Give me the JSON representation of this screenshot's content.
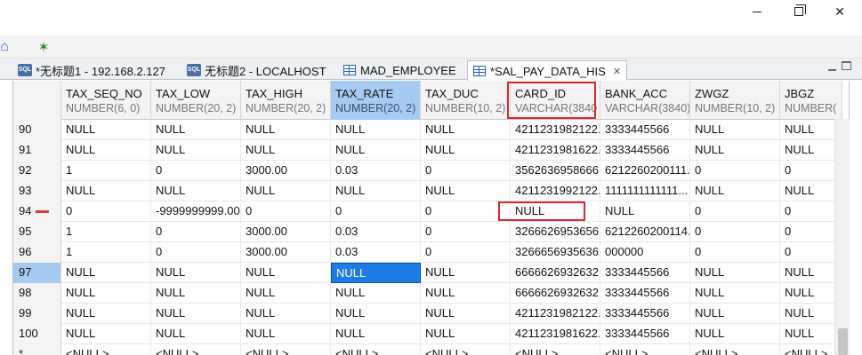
{
  "window": {
    "minimize_icon": "minimize-icon",
    "maximize_icon": "restore-icon",
    "close_label": "✕"
  },
  "toolbar": {
    "home_icon": "home-icon",
    "bug_icon": "bug-icon"
  },
  "tabs": [
    {
      "label": "*无标题1 - 192.168.2.127",
      "icon": "sql-icon",
      "badge": "SQL"
    },
    {
      "label": "无标题2 - LOCALHOST",
      "icon": "sql-icon",
      "badge": "SQL"
    },
    {
      "label": "MAD_EMPLOYEE",
      "icon": "table-icon"
    },
    {
      "label": "*SAL_PAY_DATA_HIS",
      "icon": "table-icon",
      "active": true,
      "close": "✕"
    }
  ],
  "grid": {
    "columns": [
      {
        "name": "TAX_SEQ_NO",
        "type": "NUMBER(6, 0)"
      },
      {
        "name": "TAX_LOW",
        "type": "NUMBER(20, 2)"
      },
      {
        "name": "TAX_HIGH",
        "type": "NUMBER(20, 2)"
      },
      {
        "name": "TAX_RATE",
        "type": "NUMBER(20, 2)"
      },
      {
        "name": "TAX_DUC",
        "type": "NUMBER(10, 2)"
      },
      {
        "name": "CARD_ID",
        "type": "VARCHAR(3840"
      },
      {
        "name": "BANK_ACC",
        "type": "VARCHAR(3840)"
      },
      {
        "name": "ZWGZ",
        "type": "NUMBER(10, 2)"
      },
      {
        "name": "JBGZ",
        "type": "NUMBER("
      }
    ],
    "rows": [
      {
        "num": "90",
        "cells": [
          "NULL",
          "NULL",
          "NULL",
          "NULL",
          "NULL",
          "4211231982122...",
          "3333445566",
          "NULL",
          "NULL"
        ]
      },
      {
        "num": "91",
        "cells": [
          "NULL",
          "NULL",
          "NULL",
          "NULL",
          "NULL",
          "4211231981622...",
          "3333445566",
          "NULL",
          "NULL"
        ]
      },
      {
        "num": "92",
        "cells": [
          "1",
          "0",
          "3000.00",
          "0.03",
          "0",
          "3562636958666...",
          "6212260200111...",
          "0",
          "0"
        ]
      },
      {
        "num": "93",
        "cells": [
          "NULL",
          "NULL",
          "NULL",
          "NULL",
          "NULL",
          "4211231992122...",
          "1111111111111...",
          "NULL",
          "NULL"
        ]
      },
      {
        "num": "94",
        "cells": [
          "0",
          "-9999999999.00",
          "0",
          "0",
          "0",
          "NULL",
          "NULL",
          "0",
          "0"
        ],
        "marker": true
      },
      {
        "num": "95",
        "cells": [
          "1",
          "0",
          "3000.00",
          "0.03",
          "0",
          "3266626953656...",
          "6212260200114...",
          "0",
          "0"
        ]
      },
      {
        "num": "96",
        "cells": [
          "1",
          "0",
          "3000.00",
          "0.03",
          "0",
          "3266656935636...",
          "000000",
          "0",
          "0"
        ]
      },
      {
        "num": "97",
        "cells": [
          "NULL",
          "NULL",
          "NULL",
          "NULL",
          "NULL",
          "6666626932632...",
          "3333445566",
          "NULL",
          "NULL"
        ],
        "selected": true
      },
      {
        "num": "98",
        "cells": [
          "NULL",
          "NULL",
          "NULL",
          "NULL",
          "NULL",
          "6666626932632...",
          "3333445566",
          "NULL",
          "NULL"
        ]
      },
      {
        "num": "99",
        "cells": [
          "NULL",
          "NULL",
          "NULL",
          "NULL",
          "NULL",
          "4211231982122...",
          "3333445566",
          "NULL",
          "NULL"
        ]
      },
      {
        "num": "100",
        "cells": [
          "NULL",
          "NULL",
          "NULL",
          "NULL",
          "NULL",
          "4211231981622...",
          "3333445566",
          "NULL",
          "NULL"
        ]
      },
      {
        "num": "*",
        "cells": [
          "<NULL>",
          "<NULL>",
          "<NULL>",
          "<NULL>",
          "<NULL>",
          "<NULL>",
          "<NULL>",
          "<NULL>",
          "<NULL>"
        ]
      }
    ],
    "focused_cell": {
      "row": 7,
      "col": 3
    },
    "highlighted_column": 3
  },
  "colors": {
    "selection": "#a6cbf2",
    "focus": "#1e7ce6",
    "annotation": "#e0242c"
  }
}
